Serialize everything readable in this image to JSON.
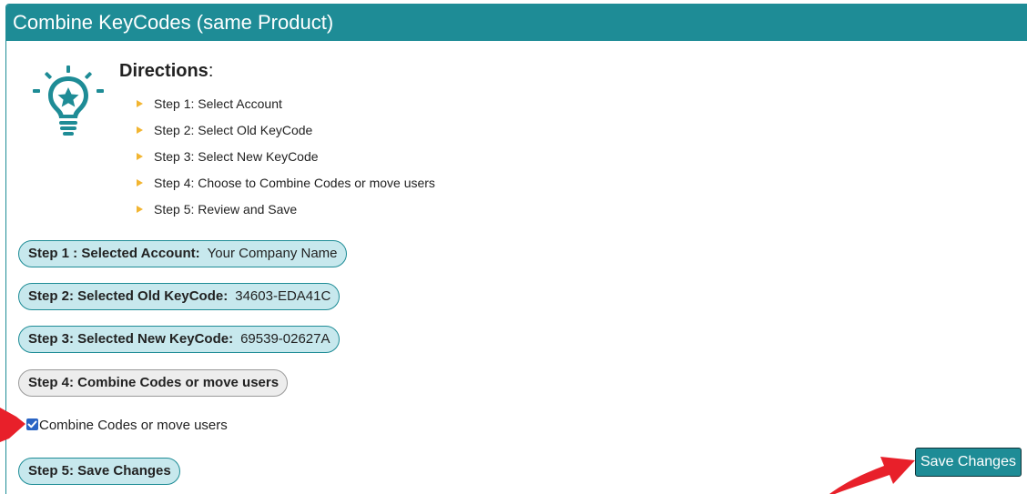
{
  "panel": {
    "title": "Combine KeyCodes (same Product)",
    "accent_color": "#1e8c96"
  },
  "directions": {
    "icon": "lightbulb-star-icon",
    "title": "Directions",
    "title_suffix": ":",
    "steps": [
      "Step 1: Select Account",
      "Step 2: Select Old KeyCode",
      "Step 3: Select New KeyCode",
      "Step 4: Choose to Combine Codes or move users",
      "Step 5: Review and Save"
    ],
    "bullet_color": "#f2b531"
  },
  "steps": {
    "step1": {
      "label": "Step 1 : Selected Account:",
      "value": "Your Company Name"
    },
    "step2": {
      "label": "Step 2: Selected Old KeyCode:",
      "value": "34603-EDA41C"
    },
    "step3": {
      "label": "Step 3: Selected New KeyCode:",
      "value": "69539-02627A"
    },
    "step4": {
      "label": "Step 4: Combine Codes or move users"
    },
    "step5": {
      "label": "Step 5: Save Changes"
    }
  },
  "combine_option": {
    "label": "Combine Codes or move users",
    "checked": true
  },
  "actions": {
    "save_label": "Save Changes"
  },
  "annotations": {
    "arrow_color": "#e8202a"
  }
}
